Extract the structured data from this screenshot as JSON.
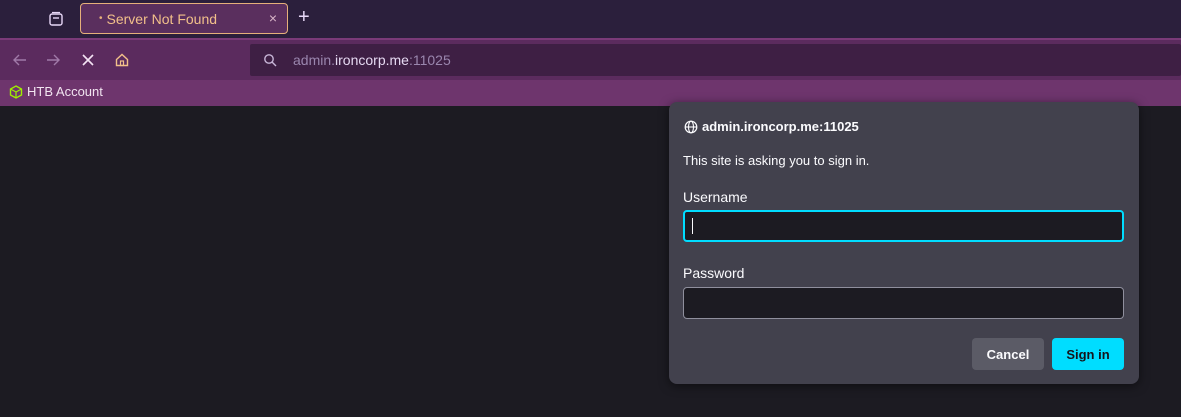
{
  "tab": {
    "title": "Server Not Found",
    "dot": "•",
    "close": "×"
  },
  "newtab_label": "+",
  "urlbar": {
    "host_prefix": "admin.",
    "host_domain": "ironcorp.me",
    "port": ":11025"
  },
  "bookmarks": [
    {
      "label": "HTB Account",
      "icon": "htb-cube-icon"
    }
  ],
  "dialog": {
    "host": "admin.ironcorp.me:11025",
    "message": "This site is asking you to sign in.",
    "username_label": "Username",
    "username_value": "",
    "password_label": "Password",
    "password_value": "",
    "cancel_label": "Cancel",
    "signin_label": "Sign in"
  },
  "colors": {
    "accent": "#00ddff",
    "tab_border": "#e6b07a",
    "toolbar": "#5b2b5e",
    "bookmarks_bar": "#6e356d",
    "htb_green": "#9fef00"
  }
}
